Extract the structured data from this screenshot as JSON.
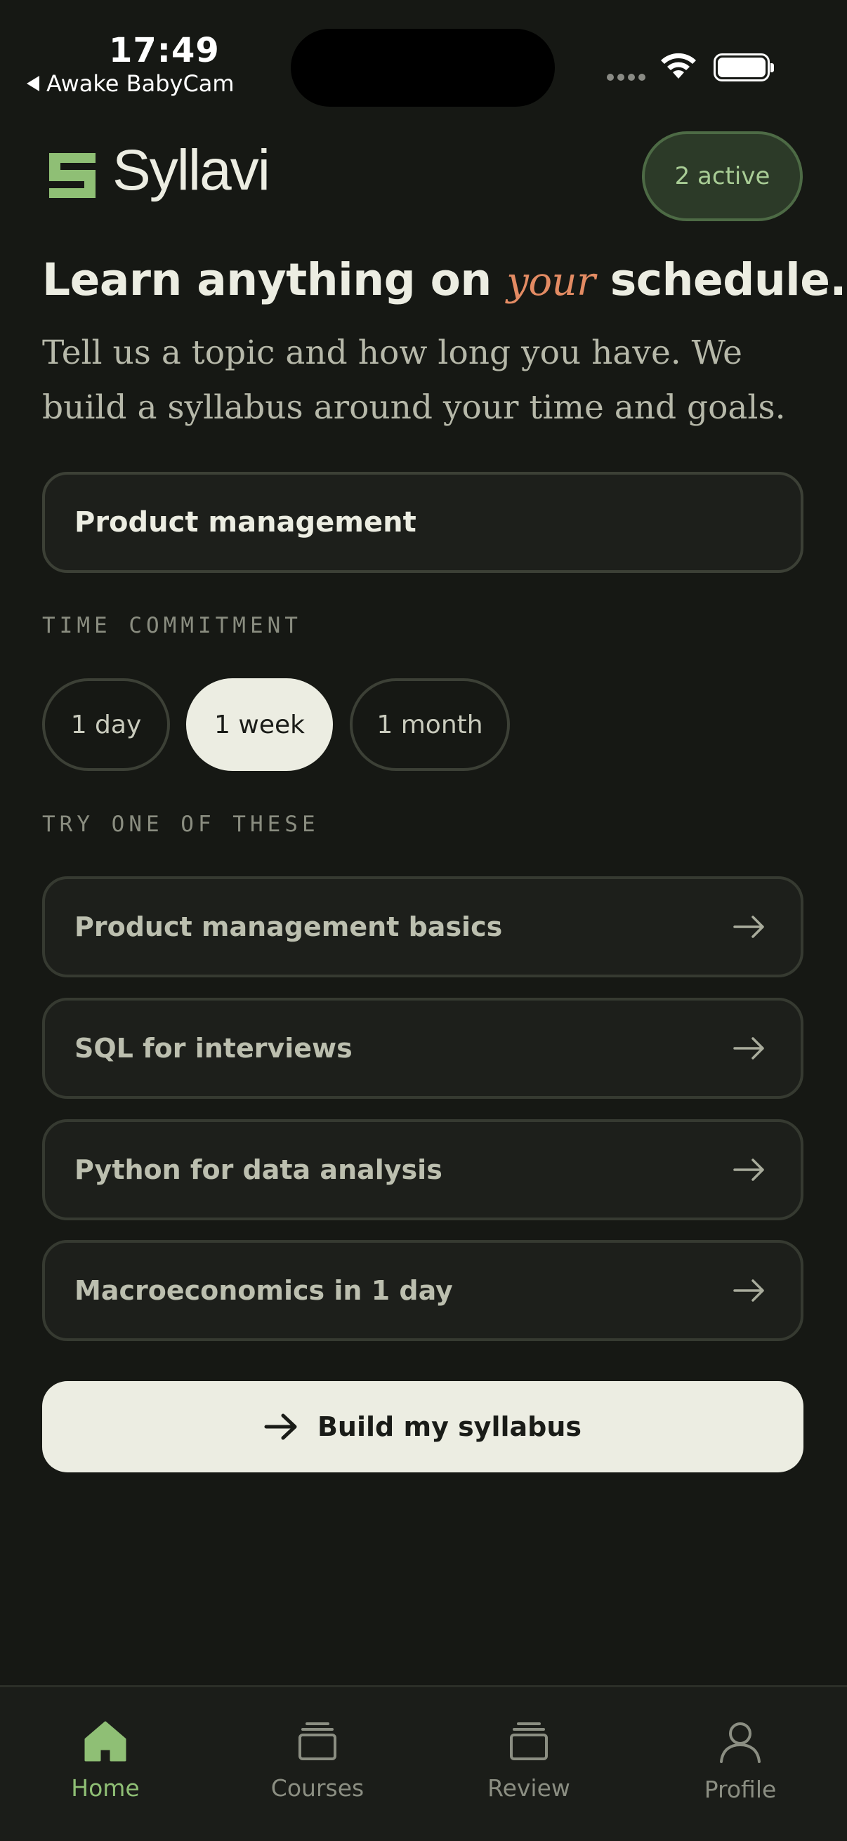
{
  "status_bar": {
    "time": "17:49",
    "back_app": "Awake BabyCam"
  },
  "header": {
    "app_name": "Syllavi",
    "active_badge": "2 active"
  },
  "hero": {
    "headline_before": "Learn anything on ",
    "headline_accent": "your",
    "headline_after": " schedule.",
    "subtitle": "Tell us a topic and how long you have. We build a syllabus around your time and goals."
  },
  "topic_input": {
    "value": "Product management"
  },
  "time_commitment": {
    "label": "TIME COMMITMENT",
    "options": [
      "1 day",
      "1 week",
      "1 month"
    ],
    "selected": "1 week"
  },
  "suggestions": {
    "label": "TRY ONE OF THESE",
    "items": [
      "Product management basics",
      "SQL for interviews",
      "Python for data analysis",
      "Macroeconomics in 1 day"
    ]
  },
  "build_button": {
    "label": "Build my syllabus"
  },
  "tab_bar": {
    "tabs": [
      "Home",
      "Courses",
      "Review",
      "Profile"
    ],
    "active": "Home"
  },
  "colors": {
    "background": "#161814",
    "accent_green": "#8fbf75",
    "accent_orange": "#e38b63",
    "text_light": "#ecede2"
  }
}
